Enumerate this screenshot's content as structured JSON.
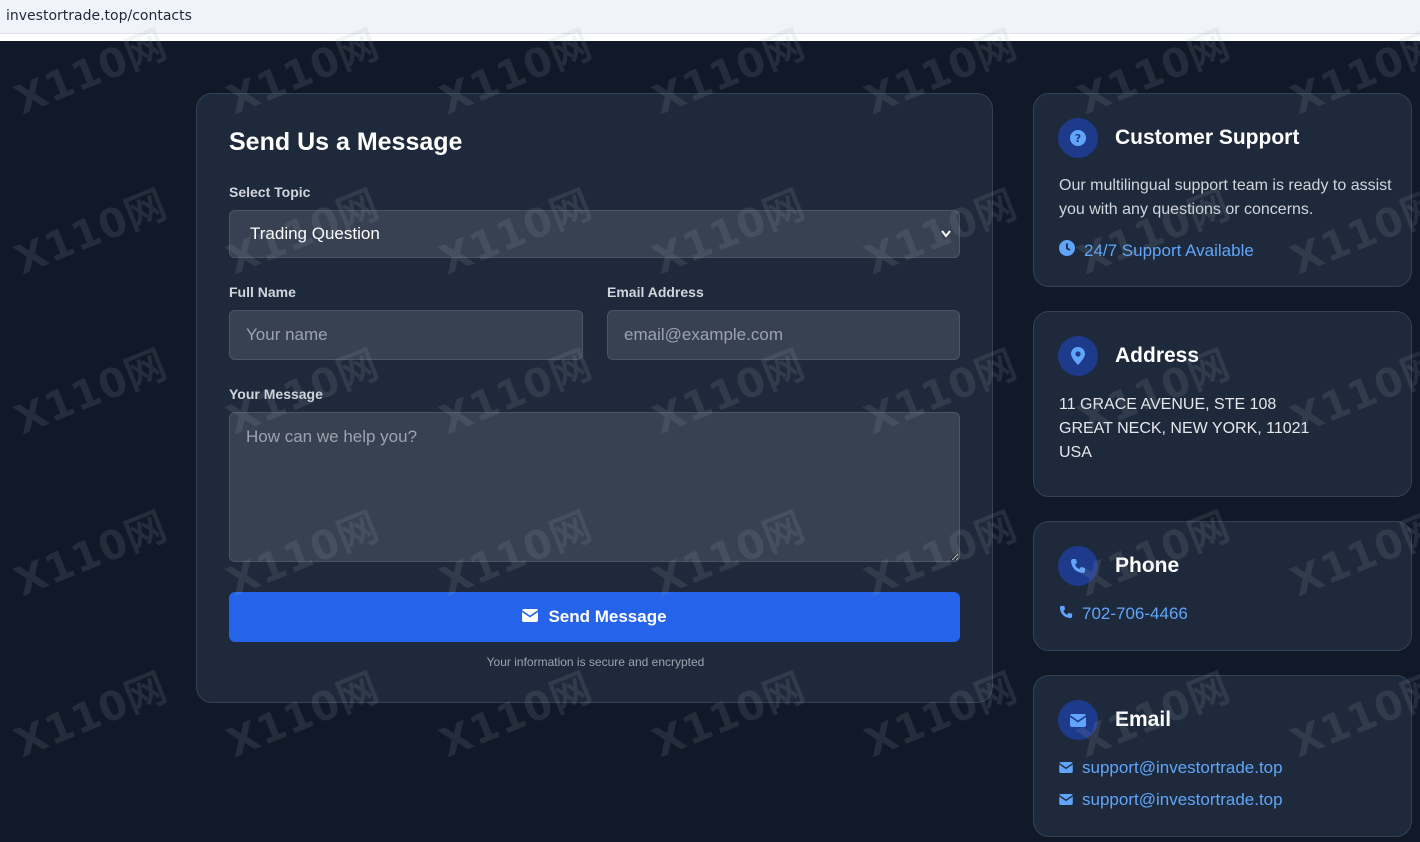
{
  "browser": {
    "url": "investortrade.top/contacts"
  },
  "form": {
    "title": "Send Us a Message",
    "topic_label": "Select Topic",
    "topic_value": "Trading Question",
    "name_label": "Full Name",
    "name_placeholder": "Your name",
    "email_label": "Email Address",
    "email_placeholder": "email@example.com",
    "message_label": "Your Message",
    "message_placeholder": "How can we help you?",
    "submit_label": "Send Message",
    "secure_note": "Your information is secure and encrypted"
  },
  "support": {
    "title": "Customer Support",
    "text": "Our multilingual support team is ready to assist you with any questions or concerns.",
    "availability": "24/7 Support Available",
    "icon": "question-icon"
  },
  "address": {
    "title": "Address",
    "lines": [
      "11 GRACE AVENUE, STE 108",
      "GREAT NECK, NEW YORK, 11021",
      "USA"
    ],
    "icon": "map-pin-icon"
  },
  "phone": {
    "title": "Phone",
    "number": "702-706-4466",
    "icon": "phone-icon"
  },
  "email": {
    "title": "Email",
    "addresses": [
      "support@investortrade.top",
      "support@investortrade.top"
    ],
    "icon": "envelope-icon"
  },
  "watermark": "X110网",
  "colors": {
    "background": "#111827",
    "card": "#1e293b",
    "accent": "#2563eb",
    "link": "#60a5fa"
  }
}
